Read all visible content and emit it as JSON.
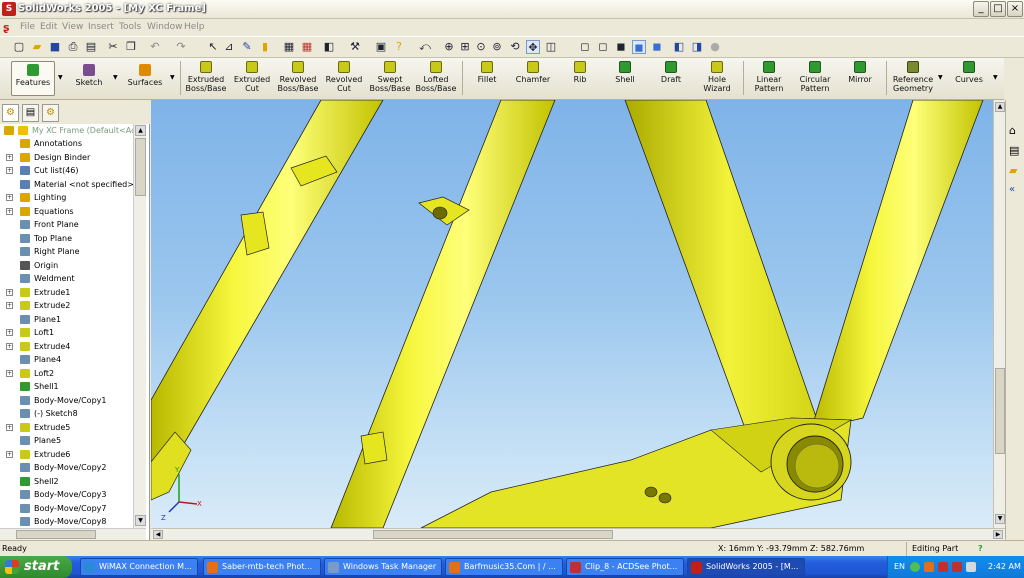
{
  "window": {
    "title": "SolidWorks 2005 - [My XC Frame]",
    "buttons": [
      "_",
      "□",
      "×"
    ]
  },
  "menu": [
    "File",
    "Edit",
    "View",
    "Insert",
    "Tools",
    "Window",
    "Help"
  ],
  "command_manager": {
    "items": [
      {
        "label": "Features",
        "color": "#2f9a2f"
      },
      {
        "label": "Sketch",
        "color": "#7a4d8f"
      },
      {
        "label": "Surfaces",
        "color": "#e08a00"
      },
      {
        "label": "Extruded\nBoss/Base",
        "color": "#c9c91a"
      },
      {
        "label": "Extruded\nCut",
        "color": "#c9c91a"
      },
      {
        "label": "Revolved\nBoss/Base",
        "color": "#c9c91a"
      },
      {
        "label": "Revolved\nCut",
        "color": "#c9c91a"
      },
      {
        "label": "Swept\nBoss/Base",
        "color": "#c9c91a"
      },
      {
        "label": "Lofted\nBoss/Base",
        "color": "#c9c91a"
      },
      {
        "label": "Fillet",
        "color": "#c9c91a"
      },
      {
        "label": "Chamfer",
        "color": "#c9c91a"
      },
      {
        "label": "Rib",
        "color": "#c9c91a"
      },
      {
        "label": "Shell",
        "color": "#2f9a2f"
      },
      {
        "label": "Draft",
        "color": "#2f9a2f"
      },
      {
        "label": "Hole\nWizard",
        "color": "#c9c91a"
      },
      {
        "label": "Linear\nPattern",
        "color": "#2f9a2f"
      },
      {
        "label": "Circular\nPattern",
        "color": "#2f9a2f"
      },
      {
        "label": "Mirror",
        "color": "#2f9a2f"
      },
      {
        "label": "Reference\nGeometry",
        "color": "#7a8a2f"
      },
      {
        "label": "Curves",
        "color": "#2f9a2f"
      }
    ]
  },
  "feature_tree": {
    "root": "My XC Frame  (Default<Ac",
    "items": [
      {
        "label": "Annotations",
        "expand": false,
        "color": "#d9a800"
      },
      {
        "label": "Design Binder",
        "expand": true,
        "color": "#d9a800"
      },
      {
        "label": "Cut list(46)",
        "expand": true,
        "color": "#5a7fb0"
      },
      {
        "label": "Material <not specified>",
        "expand": false,
        "color": "#5a7fb0"
      },
      {
        "label": "Lighting",
        "expand": true,
        "color": "#d9a800"
      },
      {
        "label": "Equations",
        "expand": true,
        "color": "#d9a800"
      },
      {
        "label": "Front Plane",
        "expand": false,
        "color": "#6b8fb0"
      },
      {
        "label": "Top Plane",
        "expand": false,
        "color": "#6b8fb0"
      },
      {
        "label": "Right Plane",
        "expand": false,
        "color": "#6b8fb0"
      },
      {
        "label": "Origin",
        "expand": false,
        "color": "#555555"
      },
      {
        "label": "Weldment",
        "expand": false,
        "color": "#6b8fb0"
      },
      {
        "label": "Extrude1",
        "expand": true,
        "color": "#c9c91a"
      },
      {
        "label": "Extrude2",
        "expand": true,
        "color": "#c9c91a"
      },
      {
        "label": "Plane1",
        "expand": false,
        "color": "#6b8fb0"
      },
      {
        "label": "Loft1",
        "expand": true,
        "color": "#c9c91a"
      },
      {
        "label": "Extrude4",
        "expand": true,
        "color": "#c9c91a"
      },
      {
        "label": "Plane4",
        "expand": false,
        "color": "#6b8fb0"
      },
      {
        "label": "Loft2",
        "expand": true,
        "color": "#c9c91a"
      },
      {
        "label": "Shell1",
        "expand": false,
        "color": "#2f9a2f"
      },
      {
        "label": "Body-Move/Copy1",
        "expand": false,
        "color": "#6b8fb0"
      },
      {
        "label": "(-) Sketch8",
        "expand": false,
        "color": "#6b8fb0"
      },
      {
        "label": "Extrude5",
        "expand": true,
        "color": "#c9c91a"
      },
      {
        "label": "Plane5",
        "expand": false,
        "color": "#6b8fb0"
      },
      {
        "label": "Extrude6",
        "expand": true,
        "color": "#c9c91a"
      },
      {
        "label": "Body-Move/Copy2",
        "expand": false,
        "color": "#6b8fb0"
      },
      {
        "label": "Shell2",
        "expand": false,
        "color": "#2f9a2f"
      },
      {
        "label": "Body-Move/Copy3",
        "expand": false,
        "color": "#6b8fb0"
      },
      {
        "label": "Body-Move/Copy7",
        "expand": false,
        "color": "#6b8fb0"
      },
      {
        "label": "Body-Move/Copy8",
        "expand": false,
        "color": "#6b8fb0"
      }
    ]
  },
  "status": {
    "left": "Ready",
    "coords": "X: 16mm  Y: -93.79mm  Z: 582.76mm",
    "mode": "Editing Part",
    "help": "?"
  },
  "taskbar": {
    "start": "start",
    "tasks": [
      {
        "label": "WiMAX Connection M...",
        "color": "#2a8ad8",
        "active": false
      },
      {
        "label": "Saber-mtb-tech Phot...",
        "color": "#e0701a",
        "active": false
      },
      {
        "label": "Windows Task Manager",
        "color": "#7a9ac8",
        "active": false
      },
      {
        "label": "Barfmusic35.Com | / ...",
        "color": "#e0701a",
        "active": false
      },
      {
        "label": "Clip_8 - ACDSee Phot...",
        "color": "#c03030",
        "active": false
      },
      {
        "label": "SolidWorks 2005 - [M...",
        "color": "#c0201a",
        "active": true
      }
    ],
    "tray_lang": "EN",
    "clock": "2:42 AM"
  }
}
